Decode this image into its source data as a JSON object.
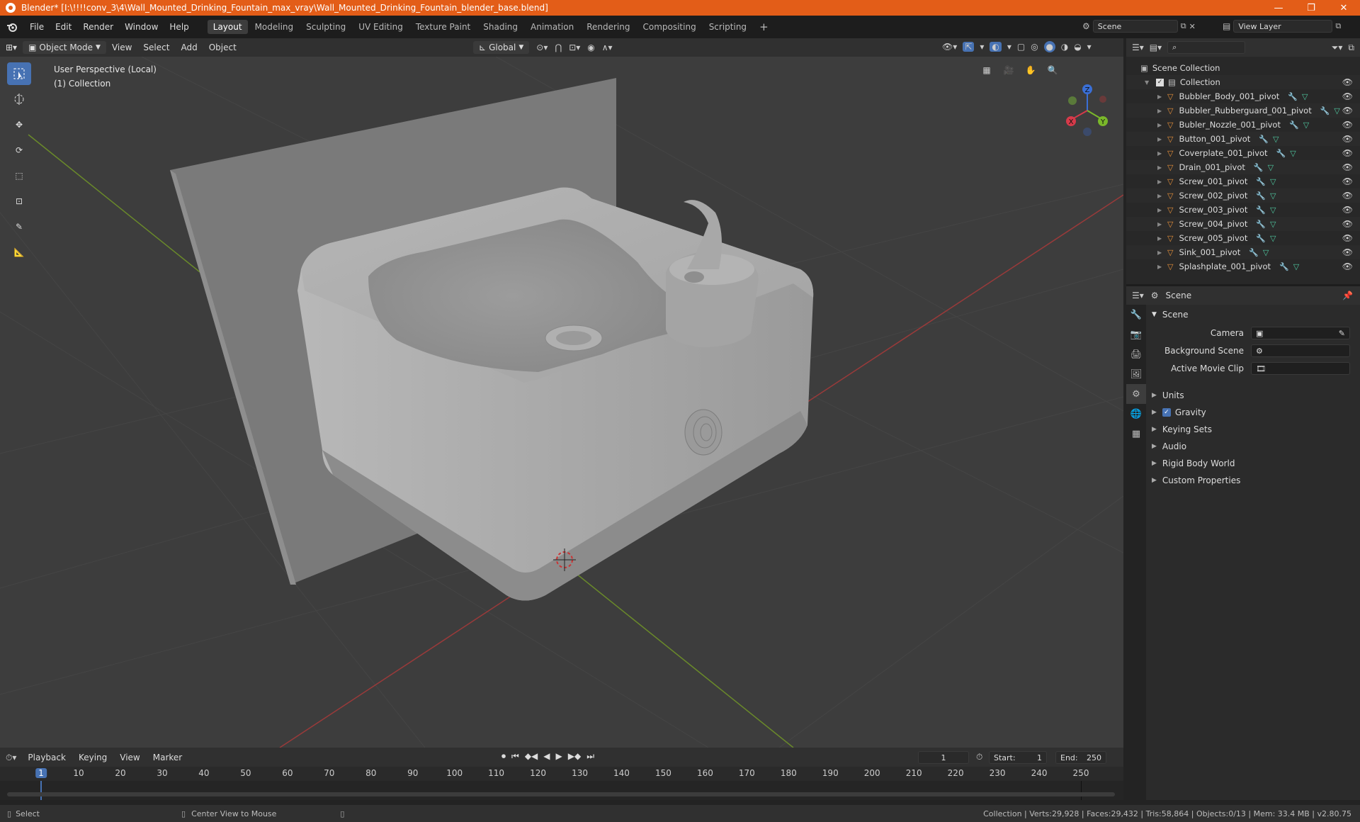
{
  "window": {
    "title": "Blender* [I:\\!!!!conv_3\\4\\Wall_Mounted_Drinking_Fountain_max_vray\\Wall_Mounted_Drinking_Fountain_blender_base.blend]",
    "controls": [
      "—",
      "❐",
      "✕"
    ]
  },
  "menu": {
    "items": [
      "File",
      "Edit",
      "Render",
      "Window",
      "Help"
    ]
  },
  "workspaces": [
    "Layout",
    "Modeling",
    "Sculpting",
    "UV Editing",
    "Texture Paint",
    "Shading",
    "Animation",
    "Rendering",
    "Compositing",
    "Scripting"
  ],
  "active_workspace": "Layout",
  "scene_selector": {
    "value": "Scene"
  },
  "view_layer": {
    "value": "View Layer"
  },
  "viewport_header": {
    "mode": "Object Mode",
    "menus": [
      "View",
      "Select",
      "Add",
      "Object"
    ],
    "transform_orientation": "Global"
  },
  "viewport": {
    "perspective_label": "User Perspective (Local)",
    "collection_label": "(1) Collection",
    "gizmo_axes": {
      "x": "X",
      "y": "Y",
      "z": "Z"
    }
  },
  "outliner": {
    "root": "Scene Collection",
    "collection": "Collection",
    "objects": [
      "Bubbler_Body_001_pivot",
      "Bubbler_Rubberguard_001_pivot",
      "Bubler_Nozzle_001_pivot",
      "Button_001_pivot",
      "Coverplate_001_pivot",
      "Drain_001_pivot",
      "Screw_001_pivot",
      "Screw_002_pivot",
      "Screw_003_pivot",
      "Screw_004_pivot",
      "Screw_005_pivot",
      "Sink_001_pivot",
      "Splashplate_001_pivot"
    ]
  },
  "properties": {
    "context": "Scene",
    "panel_title": "Scene",
    "fields": [
      {
        "label": "Camera",
        "value": ""
      },
      {
        "label": "Background Scene",
        "value": ""
      },
      {
        "label": "Active Movie Clip",
        "value": ""
      }
    ],
    "sections": [
      "Units",
      "Gravity",
      "Keying Sets",
      "Audio",
      "Rigid Body World",
      "Custom Properties"
    ],
    "gravity_checked": true
  },
  "timeline": {
    "menus": [
      "Playback",
      "Keying",
      "View",
      "Marker"
    ],
    "current_frame": "1",
    "start_label": "Start:",
    "start": "1",
    "end_label": "End:",
    "end": "250",
    "ruler": [
      "1",
      "10",
      "20",
      "30",
      "40",
      "50",
      "60",
      "70",
      "80",
      "90",
      "100",
      "110",
      "120",
      "130",
      "140",
      "150",
      "160",
      "170",
      "180",
      "190",
      "200",
      "210",
      "220",
      "230",
      "240",
      "250"
    ]
  },
  "status": {
    "left_action": "Select",
    "middle_action": "Center View to Mouse",
    "stats": "Collection | Verts:29,928 | Faces:29,432 | Tris:58,864 | Objects:0/13 | Mem: 33.4 MB | v2.80.75"
  },
  "colors": {
    "title_bar": "#e35d18",
    "accent": "#4772b3",
    "object_icon": "#e8913a",
    "mesh_icon": "#4fc9a0",
    "modifier_icon": "#6b9be0"
  }
}
